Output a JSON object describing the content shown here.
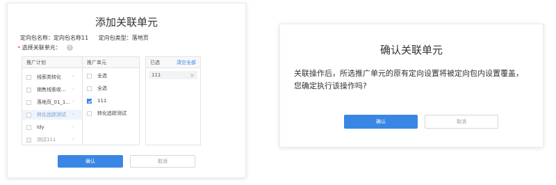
{
  "left_modal": {
    "title": "添加关联单元",
    "package_name_label": "定向包名称：定向包名称11",
    "package_type_label": "定向包类型：落地页",
    "select_label": "选择关联单元：",
    "help_glyph": "?",
    "plans_panel": {
      "header": "推广计划",
      "items": [
        {
          "label": "线索类转化",
          "checked": false,
          "highlight": false
        },
        {
          "label": "销售线索收...",
          "checked": false,
          "highlight": false
        },
        {
          "label": "落地页_01_1...",
          "checked": false,
          "highlight": false
        },
        {
          "label": "转化追踪测试",
          "checked": false,
          "highlight": true
        },
        {
          "label": "ldy",
          "checked": false,
          "highlight": false
        },
        {
          "label": "测试111",
          "checked": false,
          "highlight": false,
          "disabled": true
        }
      ]
    },
    "units_panel": {
      "header": "推广单元",
      "items": [
        {
          "label": "全选",
          "checked": false
        },
        {
          "label": "全选",
          "checked": false
        },
        {
          "label": "111",
          "checked": true
        },
        {
          "label": "转化追踪测试",
          "checked": false
        }
      ]
    },
    "selected_panel": {
      "header": "已选",
      "clear_all": "清空全部",
      "items": [
        {
          "label": "111"
        }
      ]
    },
    "confirm_label": "确认",
    "cancel_label": "取消"
  },
  "right_modal": {
    "title": "确认关联单元",
    "message": "关联操作后，所选推广单元的原有定向设置将被定向包内设置覆盖，您确定执行该操作吗?",
    "confirm_label": "确认",
    "cancel_label": "取消"
  },
  "colors": {
    "primary": "#3a86e4",
    "required": "#e0473e"
  }
}
